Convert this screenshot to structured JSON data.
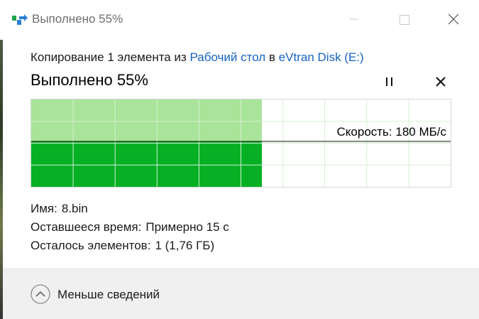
{
  "window": {
    "title": "Выполнено 55%"
  },
  "description": {
    "prefix": "Копирование 1 элемента из ",
    "source": "Рабочий стол",
    "middle": " в ",
    "destination": "eVtran Disk (E:)"
  },
  "progress": {
    "headline": "Выполнено 55%",
    "percent": 55,
    "speed_label": "Скорость: 180 МБ/с",
    "speed_level_fraction": 0.52,
    "fill_colors": {
      "done_light": "#a9e49a",
      "done_speed": "#06b025",
      "grid": "#d6efd3"
    }
  },
  "details": {
    "name_label": "Имя:",
    "name_value": "8.bin",
    "time_label": "Оставшееся время:",
    "time_value": "Примерно 15 с",
    "items_label": "Осталось элементов:",
    "items_value": "1 (1,76 ГБ)"
  },
  "footer": {
    "toggle_label": "Меньше сведений"
  },
  "icons": {
    "app": "copy-arrow-icon",
    "pause": "pause-icon",
    "cancel": "close-icon",
    "toggle": "chevron-up-icon"
  }
}
